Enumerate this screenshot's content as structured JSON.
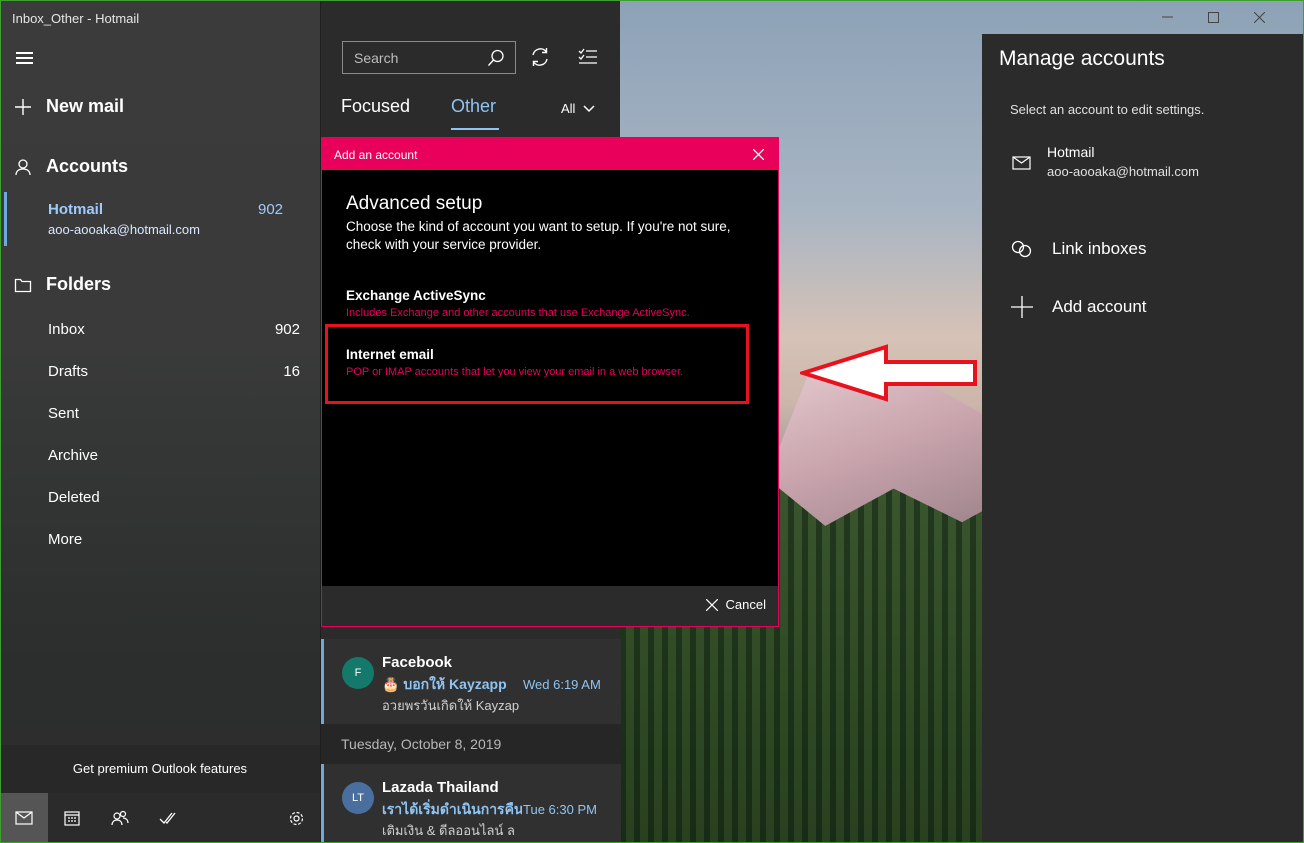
{
  "window": {
    "title": "Inbox_Other - Hotmail"
  },
  "nav": {
    "new_mail": "New mail",
    "accounts_label": "Accounts",
    "account": {
      "name": "Hotmail",
      "email": "aoo-aooaka@hotmail.com",
      "count": "902"
    },
    "folders_label": "Folders",
    "folders": [
      {
        "label": "Inbox",
        "count": "902"
      },
      {
        "label": "Drafts",
        "count": "16"
      },
      {
        "label": "Sent",
        "count": ""
      },
      {
        "label": "Archive",
        "count": ""
      },
      {
        "label": "Deleted",
        "count": ""
      },
      {
        "label": "More",
        "count": ""
      }
    ],
    "premium": "Get premium Outlook features"
  },
  "list": {
    "search_placeholder": "Search",
    "tab_focused": "Focused",
    "tab_other": "Other",
    "filter": "All",
    "messages": [
      {
        "avatar": "F",
        "avatar_color": "#137a6b",
        "sender": "Facebook",
        "subject": "🎂 บอกให้ Kayzapp",
        "time": "Wed 6:19 AM",
        "preview": "อวยพรวันเกิดให้ Kayzap"
      },
      {
        "avatar": "LT",
        "avatar_color": "#4a6f9e",
        "sender": "Lazada Thailand",
        "subject": "เราได้เริ่มดำเนินการคืน",
        "time": "Tue 6:30 PM",
        "preview": "เติมเงิน & ดีลออนไลน์ ล"
      }
    ],
    "date_header": "Tuesday, October 8, 2019"
  },
  "dialog": {
    "header": "Add an account",
    "title": "Advanced setup",
    "description": "Choose the kind of account you want to setup. If you're not sure, check with your service provider.",
    "options": [
      {
        "title": "Exchange ActiveSync",
        "desc": "Includes Exchange and other accounts that use Exchange ActiveSync."
      },
      {
        "title": "Internet email",
        "desc": "POP or IMAP accounts that let you view your email in a web browser."
      }
    ],
    "cancel": "Cancel"
  },
  "manage": {
    "title": "Manage accounts",
    "subtitle": "Select an account to edit settings.",
    "account": {
      "name": "Hotmail",
      "email": "aoo-aooaka@hotmail.com"
    },
    "link_inboxes": "Link inboxes",
    "add_account": "Add account"
  },
  "colors": {
    "accent": "#e8005b",
    "highlight": "#e8111e",
    "link_blue": "#8fc4f2"
  }
}
